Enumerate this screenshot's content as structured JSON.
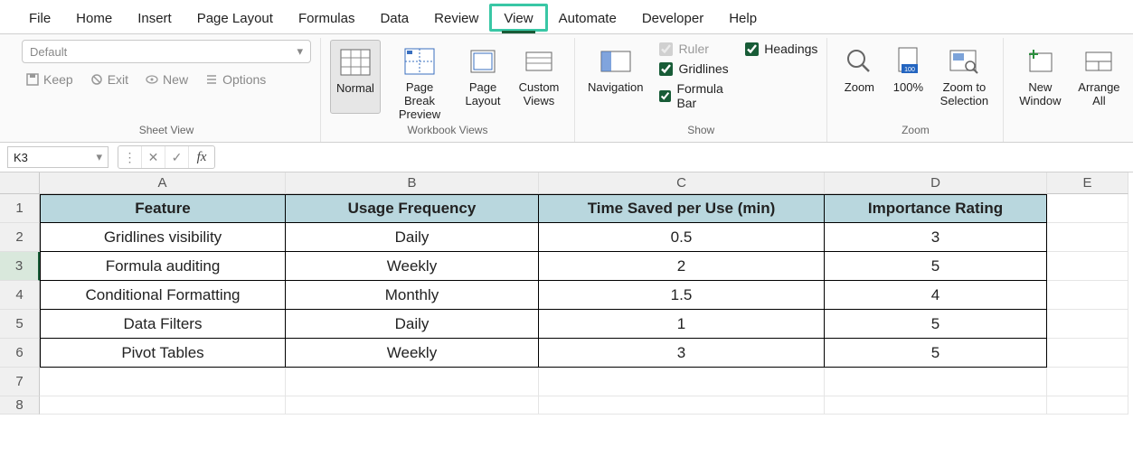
{
  "tabs": {
    "file": "File",
    "home": "Home",
    "insert": "Insert",
    "page_layout": "Page Layout",
    "formulas": "Formulas",
    "data": "Data",
    "review": "Review",
    "view": "View",
    "automate": "Automate",
    "developer": "Developer",
    "help": "Help"
  },
  "active_tab": "view",
  "ribbon": {
    "sheet_view": {
      "dropdown": "Default",
      "keep": "Keep",
      "exit": "Exit",
      "new": "New",
      "options": "Options",
      "label": "Sheet View"
    },
    "workbook_views": {
      "normal": "Normal",
      "page_break": "Page Break Preview",
      "page_layout": "Page Layout",
      "custom": "Custom Views",
      "label": "Workbook Views"
    },
    "navigation": {
      "btn": "Navigation"
    },
    "show": {
      "ruler": "Ruler",
      "gridlines": "Gridlines",
      "formula_bar": "Formula Bar",
      "headings": "Headings",
      "label": "Show"
    },
    "zoom": {
      "zoom": "Zoom",
      "hundred": "100%",
      "to_sel": "Zoom to Selection",
      "label": "Zoom"
    },
    "window": {
      "new": "New Window",
      "arrange": "Arrange All"
    }
  },
  "formula_bar": {
    "namebox": "K3",
    "fx": "fx",
    "value": ""
  },
  "columns": [
    "A",
    "B",
    "C",
    "D",
    "E"
  ],
  "rows": [
    "1",
    "2",
    "3",
    "4",
    "5",
    "6",
    "7",
    "8"
  ],
  "selected_row": "3",
  "grid": {
    "headers": [
      "Feature",
      "Usage Frequency",
      "Time Saved per Use (min)",
      "Importance Rating"
    ],
    "data": [
      [
        "Gridlines visibility",
        "Daily",
        "0.5",
        "3"
      ],
      [
        "Formula auditing",
        "Weekly",
        "2",
        "5"
      ],
      [
        "Conditional Formatting",
        "Monthly",
        "1.5",
        "4"
      ],
      [
        "Data Filters",
        "Daily",
        "1",
        "5"
      ],
      [
        "Pivot Tables",
        "Weekly",
        "3",
        "5"
      ]
    ]
  }
}
